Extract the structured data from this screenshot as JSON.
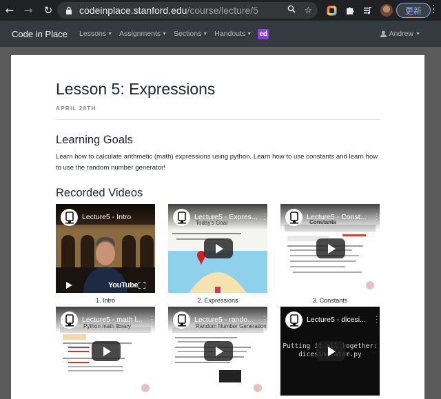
{
  "browser": {
    "url_host": "codeinplace.stanford.edu",
    "url_path": "/course/lecture/5",
    "update_label": "更新"
  },
  "navbar": {
    "brand": "Code in Place",
    "items": [
      {
        "label": "Lessons"
      },
      {
        "label": "Assignments"
      },
      {
        "label": "Sections"
      },
      {
        "label": "Handouts"
      }
    ],
    "ed_badge": "ed",
    "user": "Andrew"
  },
  "lesson": {
    "title": "Lesson 5: Expressions",
    "date": "APRIL 28TH",
    "goals_heading": "Learning Goals",
    "goals_text": "Learn how to calculate arithmetic (math) expressions using python. Learn how to use constants and learn how to use the random number generator!",
    "videos_heading": "Recorded Videos"
  },
  "videos": [
    {
      "title": "Lecture5 - Intro",
      "caption": "1. Intro",
      "youtube_logo": "YouTube"
    },
    {
      "title": "Lecture5 - Expres...",
      "caption": "2. Expressions",
      "slide_heading": "Today's Goal"
    },
    {
      "title": "Lecture5 - Const...",
      "caption": "3. Constants",
      "slide_heading": "Constants"
    },
    {
      "title": "Lecture5 - math l...",
      "caption": "",
      "slide_heading": "Python math library"
    },
    {
      "title": "Lecture5 - rando...",
      "caption": "",
      "slide_heading": "Random Number Generation"
    },
    {
      "title": "Lecture5 - dicesi...",
      "caption": "",
      "code_line1": "Putting it all together:",
      "code_line2": "dicesimulator.py"
    }
  ],
  "colors": {
    "navbar_bg": "#343a40",
    "ed_badge": "#8d3fd6",
    "browser_chrome": "#202124"
  }
}
